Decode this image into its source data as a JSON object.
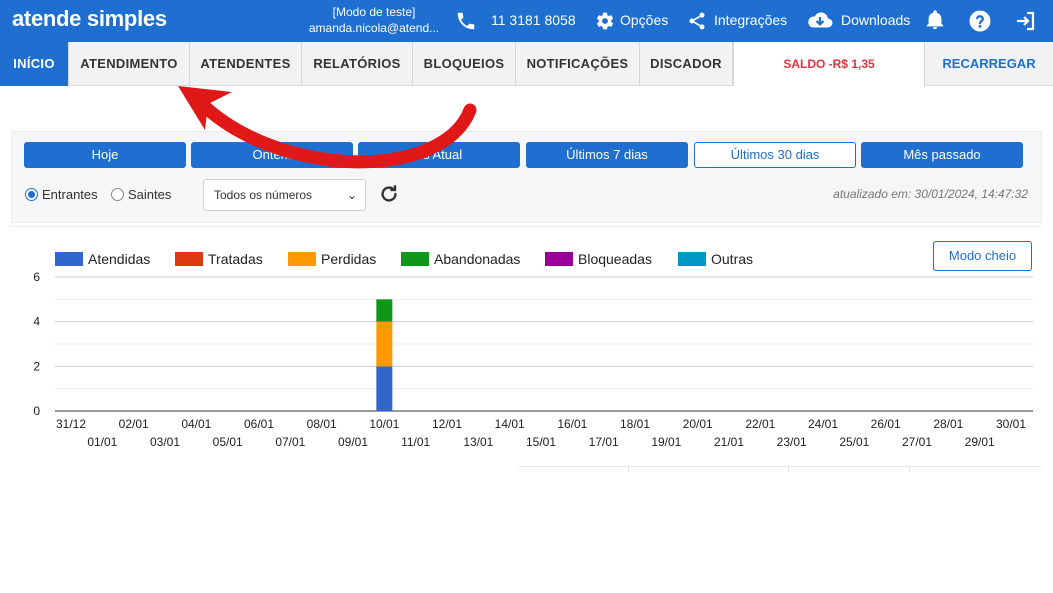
{
  "header": {
    "brand": "atende simples",
    "account_line1": "[Modo de teste]",
    "account_line2": "amanda.nicola@atend...",
    "phone": "11 3181 8058",
    "options_label": "Opções",
    "integrations_label": "Integrações",
    "downloads_label": "Downloads"
  },
  "nav": {
    "items": [
      "INÍCIO",
      "ATENDIMENTO",
      "ATENDENTES",
      "RELATÓRIOS",
      "BLOQUEIOS",
      "NOTIFICAÇÕES",
      "DISCADOR"
    ],
    "active": "INÍCIO",
    "saldo": "SALDO -R$ 1,35",
    "recarregar": "RECARREGAR"
  },
  "filters": {
    "ranges": [
      "Hoje",
      "Ontem",
      "Mês Atual",
      "Últimos 7 dias",
      "Últimos 30 dias",
      "Mês passado"
    ],
    "range_labels_visible": [
      "Hoje",
      "Ontem",
      "es Atual",
      "Últimos 7 dias",
      "Últimos 30 dias",
      "Mês passado"
    ],
    "selected_range": "Últimos 30 dias",
    "direction_options": [
      "Entrantes",
      "Saintes"
    ],
    "selected_direction": "Entrantes",
    "number_select": "Todos os números",
    "updated_at": "atualizado em: 30/01/2024, 14:47:32"
  },
  "chart": {
    "full_mode_label": "Modo cheio"
  },
  "colors": {
    "brand": "#1e6fd0",
    "saldo": "#e0333d",
    "annotation_arrow": "#e01818"
  },
  "chart_data": {
    "type": "bar",
    "stacked": true,
    "categories": [
      "31/12",
      "01/01",
      "02/01",
      "03/01",
      "04/01",
      "05/01",
      "06/01",
      "07/01",
      "08/01",
      "09/01",
      "10/01",
      "11/01",
      "12/01",
      "13/01",
      "14/01",
      "15/01",
      "16/01",
      "17/01",
      "18/01",
      "19/01",
      "20/01",
      "21/01",
      "22/01",
      "23/01",
      "24/01",
      "25/01",
      "26/01",
      "27/01",
      "28/01",
      "29/01",
      "30/01"
    ],
    "series": [
      {
        "name": "Atendidas",
        "color": "#3366cc",
        "values": [
          0,
          0,
          0,
          0,
          0,
          0,
          0,
          0,
          0,
          0,
          2,
          0,
          0,
          0,
          0,
          0,
          0,
          0,
          0,
          0,
          0,
          0,
          0,
          0,
          0,
          0,
          0,
          0,
          0,
          0,
          0
        ]
      },
      {
        "name": "Tratadas",
        "color": "#dc3912",
        "values": [
          0,
          0,
          0,
          0,
          0,
          0,
          0,
          0,
          0,
          0,
          0,
          0,
          0,
          0,
          0,
          0,
          0,
          0,
          0,
          0,
          0,
          0,
          0,
          0,
          0,
          0,
          0,
          0,
          0,
          0,
          0
        ]
      },
      {
        "name": "Perdidas",
        "color": "#ff9900",
        "values": [
          0,
          0,
          0,
          0,
          0,
          0,
          0,
          0,
          0,
          0,
          2,
          0,
          0,
          0,
          0,
          0,
          0,
          0,
          0,
          0,
          0,
          0,
          0,
          0,
          0,
          0,
          0,
          0,
          0,
          0,
          0
        ]
      },
      {
        "name": "Abandonadas",
        "color": "#109618",
        "values": [
          0,
          0,
          0,
          0,
          0,
          0,
          0,
          0,
          0,
          0,
          1,
          0,
          0,
          0,
          0,
          0,
          0,
          0,
          0,
          0,
          0,
          0,
          0,
          0,
          0,
          0,
          0,
          0,
          0,
          0,
          0
        ]
      },
      {
        "name": "Bloqueadas",
        "color": "#990099",
        "values": [
          0,
          0,
          0,
          0,
          0,
          0,
          0,
          0,
          0,
          0,
          0,
          0,
          0,
          0,
          0,
          0,
          0,
          0,
          0,
          0,
          0,
          0,
          0,
          0,
          0,
          0,
          0,
          0,
          0,
          0,
          0
        ]
      },
      {
        "name": "Outras",
        "color": "#0099c6",
        "values": [
          0,
          0,
          0,
          0,
          0,
          0,
          0,
          0,
          0,
          0,
          0,
          0,
          0,
          0,
          0,
          0,
          0,
          0,
          0,
          0,
          0,
          0,
          0,
          0,
          0,
          0,
          0,
          0,
          0,
          0,
          0
        ]
      }
    ],
    "yticks": [
      0,
      2,
      4,
      6
    ],
    "ylim": [
      0,
      6
    ],
    "legend_position": "top-left",
    "grid": true
  }
}
